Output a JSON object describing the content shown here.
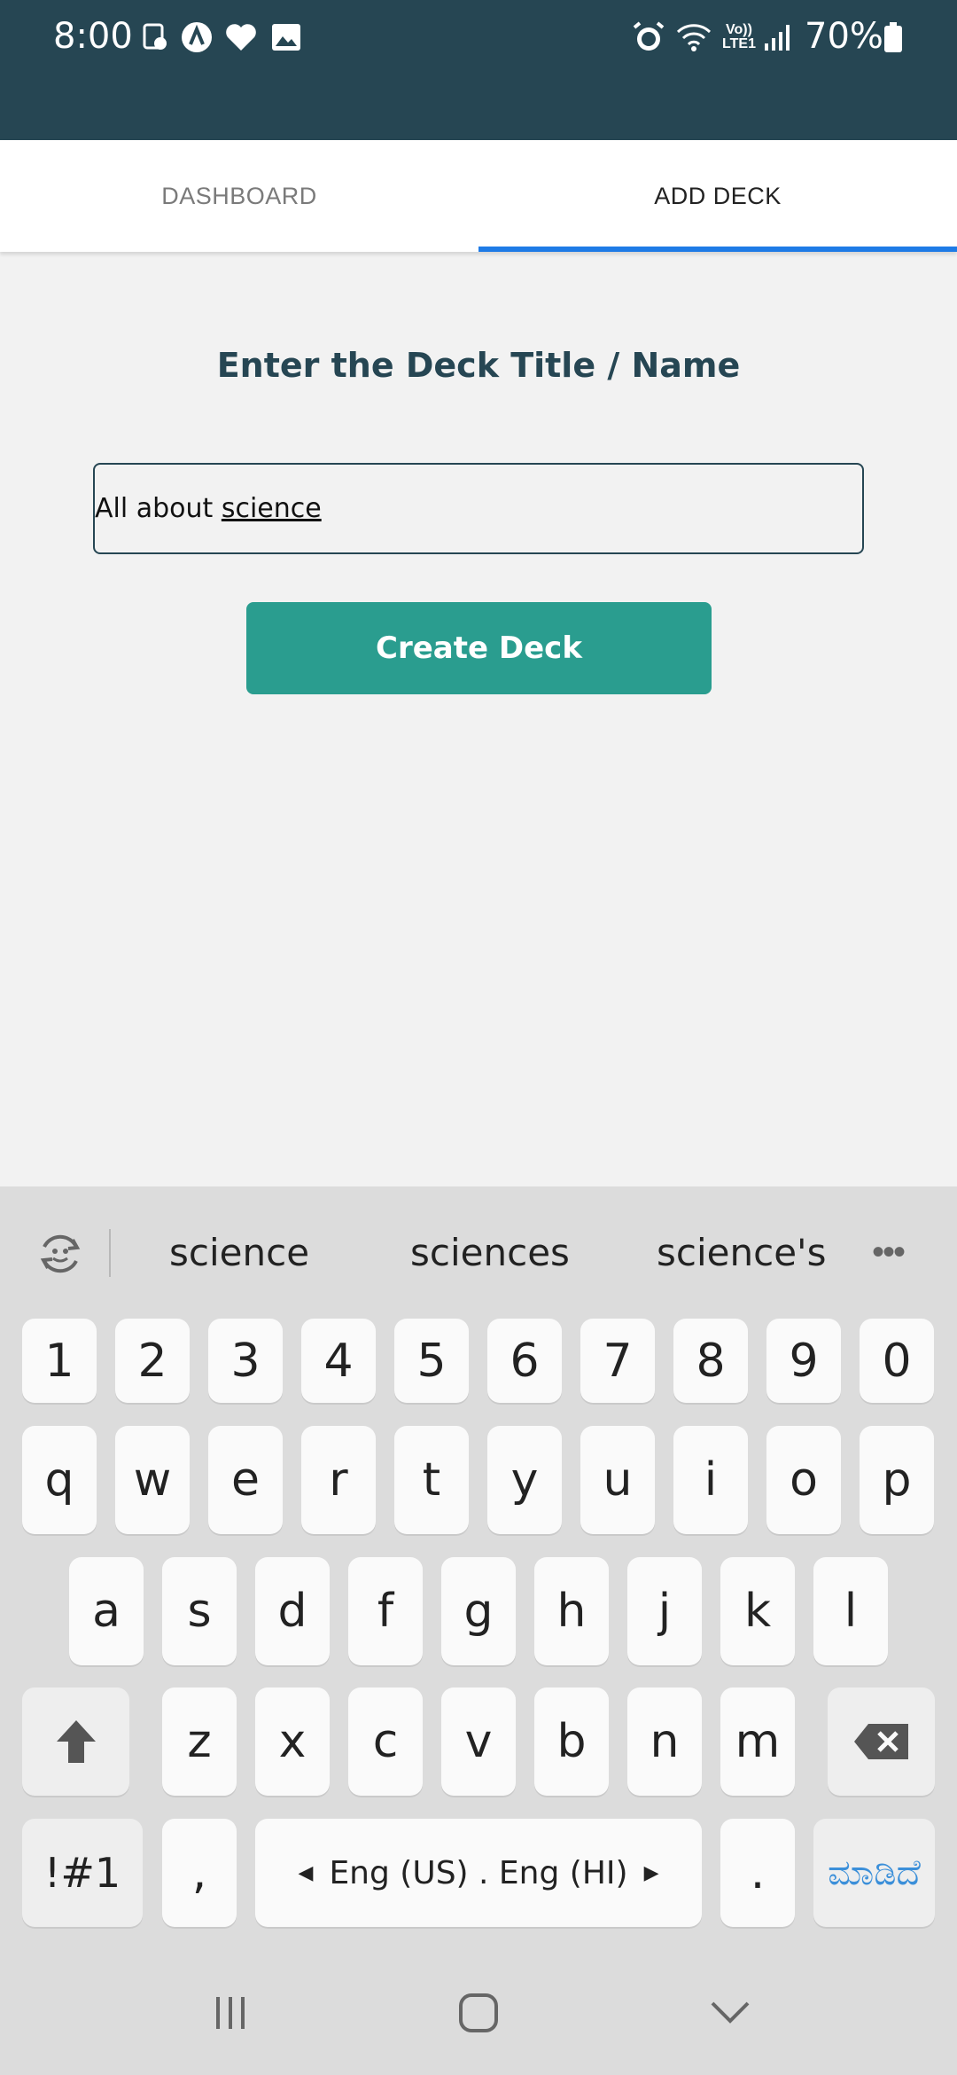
{
  "status_bar": {
    "time": "8:00",
    "battery_percent": "70%",
    "icons_left": [
      "reminder-icon",
      "app-a-icon",
      "health-icon",
      "gallery-icon"
    ],
    "icons_right": [
      "alarm-icon",
      "wifi-icon",
      "volte-icon",
      "signal-icon",
      "battery-icon"
    ],
    "network_label": "Vo)) LTE1"
  },
  "tabs": [
    {
      "label": "DASHBOARD",
      "active": false
    },
    {
      "label": "ADD DECK",
      "active": true
    }
  ],
  "main": {
    "heading": "Enter the Deck Title / Name",
    "input_text_prefix": "All about ",
    "input_text_underlined": "science",
    "create_button_label": "Create Deck"
  },
  "keyboard": {
    "suggestions": [
      "science",
      "sciences",
      "science's"
    ],
    "number_row": [
      "1",
      "2",
      "3",
      "4",
      "5",
      "6",
      "7",
      "8",
      "9",
      "0"
    ],
    "row1": [
      "q",
      "w",
      "e",
      "r",
      "t",
      "y",
      "u",
      "i",
      "o",
      "p"
    ],
    "row2": [
      "a",
      "s",
      "d",
      "f",
      "g",
      "h",
      "j",
      "k",
      "l"
    ],
    "row3": [
      "z",
      "x",
      "c",
      "v",
      "b",
      "n",
      "m"
    ],
    "symbols_label": "!#1",
    "comma_label": ",",
    "space_label": "Eng (US) . Eng (HI)",
    "period_label": ".",
    "action_label": "ಮಾಡಿದೆ"
  },
  "colors": {
    "status_bar_bg": "#264653",
    "accent_tab": "#1e7be6",
    "heading": "#264653",
    "button_bg": "#2a9d8f",
    "action_key_text": "#3b8fd9"
  }
}
